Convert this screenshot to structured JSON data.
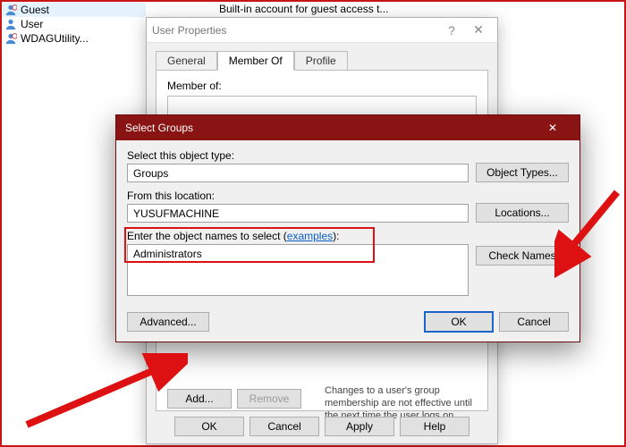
{
  "list": {
    "rows": [
      {
        "name": "Guest"
      },
      {
        "name": "User"
      },
      {
        "name": "WDAGUtility..."
      }
    ],
    "desc_truncated": "Built-in account for guest access t..."
  },
  "props": {
    "title": "User Properties",
    "help_glyph": "?",
    "close_glyph": "✕",
    "tabs": {
      "general": "General",
      "memberof": "Member Of",
      "profile": "Profile"
    },
    "memberof_label": "Member of:",
    "add_btn": "Add...",
    "remove_btn": "Remove",
    "note": "Changes to a user's group membership are not effective until the next time the user logs on.",
    "ok": "OK",
    "cancel": "Cancel",
    "apply": "Apply",
    "help": "Help"
  },
  "selgrp": {
    "title": "Select Groups",
    "close_glyph": "✕",
    "type_label": "Select this object type:",
    "type_value": "Groups",
    "type_btn": "Object Types...",
    "loc_label": "From this location:",
    "loc_value": "YUSUFMACHINE",
    "loc_btn": "Locations...",
    "names_label_a": "Enter the object names to select (",
    "names_label_link": "examples",
    "names_label_b": "):",
    "names_value": "Administrators",
    "check_btn": "Check Names",
    "advanced": "Advanced...",
    "ok": "OK",
    "cancel": "Cancel"
  }
}
